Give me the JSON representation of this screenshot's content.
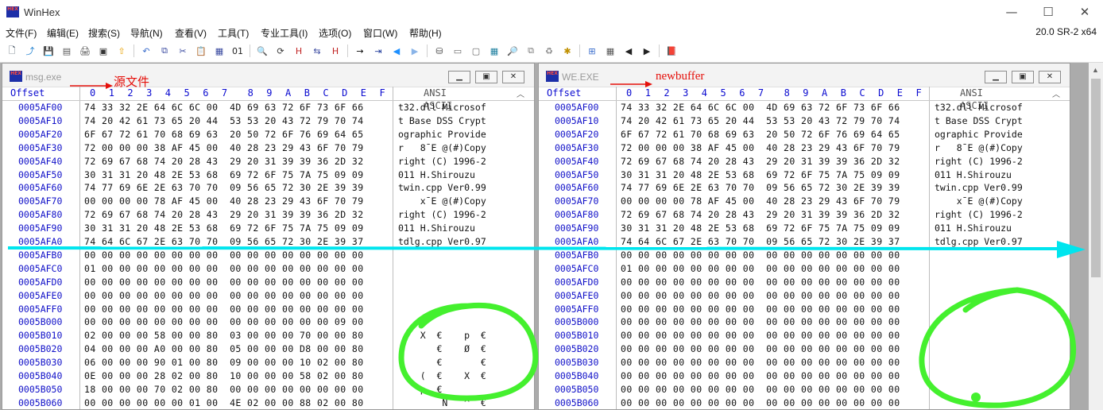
{
  "app": {
    "title": "WinHex",
    "icon_text": "HEX",
    "version": "20.0 SR-2 x64",
    "window_buttons": [
      "—",
      "☐",
      "✕"
    ]
  },
  "menu": [
    "文件(F)",
    "编辑(E)",
    "搜索(S)",
    "导航(N)",
    "查看(V)",
    "工具(T)",
    "专业工具(I)",
    "选项(O)",
    "窗口(W)",
    "帮助(H)"
  ],
  "toolbar_icons": [
    "new-file-icon",
    "open-file-icon",
    "save-icon",
    "save-all-icon",
    "print-icon",
    "properties-icon",
    "open-folder-icon",
    "undo-icon",
    "copy-icon",
    "cut-icon",
    "paste-icon",
    "paste-special-icon",
    "binary-icon",
    "find-icon",
    "find-again-icon",
    "find-hex-icon",
    "replace-icon",
    "replace-hex-icon",
    "goto-offset-icon",
    "goto-sector-icon",
    "back-icon",
    "forward-icon",
    "open-disk-icon",
    "open-ram-icon",
    "hdd-icon",
    "calculator-icon",
    "search-disk-icon",
    "clone-icon",
    "recover-icon",
    "plugin-icon",
    "compare-icon",
    "table-icon",
    "prev-icon",
    "next-icon",
    "book-icon"
  ],
  "colors": {
    "annotation_red": "#e5100b",
    "cyan_arrow": "#00e5ee",
    "green_circle": "#44f02e",
    "offset_blue": "#1010c8"
  },
  "header": {
    "offset_label": "Offset",
    "hex_labels": [
      "0",
      "1",
      "2",
      "3",
      "4",
      "5",
      "6",
      "7",
      "8",
      "9",
      "A",
      "B",
      "C",
      "D",
      "E",
      "F"
    ],
    "ansi_label": "ANSI ASCII"
  },
  "left_panel": {
    "title": "msg.exe",
    "annotation": "源文件",
    "rows": [
      {
        "offset": "0005AF00",
        "hex": "74 33 32 2E 64 6C 6C 00  4D 69 63 72 6F 73 6F 66",
        "ansi": "t32.dll Microsof"
      },
      {
        "offset": "0005AF10",
        "hex": "74 20 42 61 73 65 20 44  53 53 20 43 72 79 70 74",
        "ansi": "t Base DSS Crypt"
      },
      {
        "offset": "0005AF20",
        "hex": "6F 67 72 61 70 68 69 63  20 50 72 6F 76 69 64 65",
        "ansi": "ographic Provide"
      },
      {
        "offset": "0005AF30",
        "hex": "72 00 00 00 38 AF 45 00  40 28 23 29 43 6F 70 79",
        "ansi": "r   8¯E @(#)Copy"
      },
      {
        "offset": "0005AF40",
        "hex": "72 69 67 68 74 20 28 43  29 20 31 39 39 36 2D 32",
        "ansi": "right (C) 1996-2"
      },
      {
        "offset": "0005AF50",
        "hex": "30 31 31 20 48 2E 53 68  69 72 6F 75 7A 75 09 09",
        "ansi": "011 H.Shirouzu  "
      },
      {
        "offset": "0005AF60",
        "hex": "74 77 69 6E 2E 63 70 70  09 56 65 72 30 2E 39 39",
        "ansi": "twin.cpp Ver0.99"
      },
      {
        "offset": "0005AF70",
        "hex": "00 00 00 00 78 AF 45 00  40 28 23 29 43 6F 70 79",
        "ansi": "    x¯E @(#)Copy"
      },
      {
        "offset": "0005AF80",
        "hex": "72 69 67 68 74 20 28 43  29 20 31 39 39 36 2D 32",
        "ansi": "right (C) 1996-2"
      },
      {
        "offset": "0005AF90",
        "hex": "30 31 31 20 48 2E 53 68  69 72 6F 75 7A 75 09 09",
        "ansi": "011 H.Shirouzu  "
      },
      {
        "offset": "0005AFA0",
        "hex": "74 64 6C 67 2E 63 70 70  09 56 65 72 30 2E 39 37",
        "ansi": "tdlg.cpp Ver0.97"
      },
      {
        "offset": "0005AFB0",
        "hex": "00 00 00 00 00 00 00 00  00 00 00 00 00 00 00 00",
        "ansi": ""
      },
      {
        "offset": "0005AFC0",
        "hex": "01 00 00 00 00 00 00 00  00 00 00 00 00 00 00 00",
        "ansi": ""
      },
      {
        "offset": "0005AFD0",
        "hex": "00 00 00 00 00 00 00 00  00 00 00 00 00 00 00 00",
        "ansi": ""
      },
      {
        "offset": "0005AFE0",
        "hex": "00 00 00 00 00 00 00 00  00 00 00 00 00 00 00 00",
        "ansi": ""
      },
      {
        "offset": "0005AFF0",
        "hex": "00 00 00 00 00 00 00 00  00 00 00 00 00 00 00 00",
        "ansi": ""
      },
      {
        "offset": "0005B000",
        "hex": "00 00 00 00 00 00 00 00  00 00 00 00 00 00 09 00",
        "ansi": ""
      },
      {
        "offset": "0005B010",
        "hex": "02 00 00 00 58 00 00 80  03 00 00 00 70 00 00 80",
        "ansi": "    X  €    p  €"
      },
      {
        "offset": "0005B020",
        "hex": "04 00 00 00 A0 00 00 80  05 00 00 00 D8 00 00 80",
        "ansi": "       €    Ø  €"
      },
      {
        "offset": "0005B030",
        "hex": "06 00 00 00 90 01 00 80  09 00 00 00 10 02 00 80",
        "ansi": "       €       €"
      },
      {
        "offset": "0005B040",
        "hex": "0E 00 00 00 28 02 00 80  10 00 00 00 58 02 00 80",
        "ansi": "    (  €    X  €"
      },
      {
        "offset": "0005B050",
        "hex": "18 00 00 00 70 02 00 80  00 00 00 00 00 00 00 00",
        "ansi": "    p  €        "
      },
      {
        "offset": "0005B060",
        "hex": "00 00 00 00 00 00 01 00  4E 02 00 00 88 02 00 80",
        "ansi": "        N   ^  €"
      }
    ]
  },
  "right_panel": {
    "title": "WE.EXE",
    "annotation": "newbuffer",
    "rows": [
      {
        "offset": "0005AF00",
        "hex": "74 33 32 2E 64 6C 6C 00  4D 69 63 72 6F 73 6F 66",
        "ansi": "t32.dll Microsof"
      },
      {
        "offset": "0005AF10",
        "hex": "74 20 42 61 73 65 20 44  53 53 20 43 72 79 70 74",
        "ansi": "t Base DSS Crypt"
      },
      {
        "offset": "0005AF20",
        "hex": "6F 67 72 61 70 68 69 63  20 50 72 6F 76 69 64 65",
        "ansi": "ographic Provide"
      },
      {
        "offset": "0005AF30",
        "hex": "72 00 00 00 38 AF 45 00  40 28 23 29 43 6F 70 79",
        "ansi": "r   8¯E @(#)Copy"
      },
      {
        "offset": "0005AF40",
        "hex": "72 69 67 68 74 20 28 43  29 20 31 39 39 36 2D 32",
        "ansi": "right (C) 1996-2"
      },
      {
        "offset": "0005AF50",
        "hex": "30 31 31 20 48 2E 53 68  69 72 6F 75 7A 75 09 09",
        "ansi": "011 H.Shirouzu  "
      },
      {
        "offset": "0005AF60",
        "hex": "74 77 69 6E 2E 63 70 70  09 56 65 72 30 2E 39 39",
        "ansi": "twin.cpp Ver0.99"
      },
      {
        "offset": "0005AF70",
        "hex": "00 00 00 00 78 AF 45 00  40 28 23 29 43 6F 70 79",
        "ansi": "    x¯E @(#)Copy"
      },
      {
        "offset": "0005AF80",
        "hex": "72 69 67 68 74 20 28 43  29 20 31 39 39 36 2D 32",
        "ansi": "right (C) 1996-2"
      },
      {
        "offset": "0005AF90",
        "hex": "30 31 31 20 48 2E 53 68  69 72 6F 75 7A 75 09 09",
        "ansi": "011 H.Shirouzu  "
      },
      {
        "offset": "0005AFA0",
        "hex": "74 64 6C 67 2E 63 70 70  09 56 65 72 30 2E 39 37",
        "ansi": "tdlg.cpp Ver0.97"
      },
      {
        "offset": "0005AFB0",
        "hex": "00 00 00 00 00 00 00 00  00 00 00 00 00 00 00 00",
        "ansi": ""
      },
      {
        "offset": "0005AFC0",
        "hex": "01 00 00 00 00 00 00 00  00 00 00 00 00 00 00 00",
        "ansi": ""
      },
      {
        "offset": "0005AFD0",
        "hex": "00 00 00 00 00 00 00 00  00 00 00 00 00 00 00 00",
        "ansi": ""
      },
      {
        "offset": "0005AFE0",
        "hex": "00 00 00 00 00 00 00 00  00 00 00 00 00 00 00 00",
        "ansi": ""
      },
      {
        "offset": "0005AFF0",
        "hex": "00 00 00 00 00 00 00 00  00 00 00 00 00 00 00 00",
        "ansi": ""
      },
      {
        "offset": "0005B000",
        "hex": "00 00 00 00 00 00 00 00  00 00 00 00 00 00 00 00",
        "ansi": ""
      },
      {
        "offset": "0005B010",
        "hex": "00 00 00 00 00 00 00 00  00 00 00 00 00 00 00 00",
        "ansi": ""
      },
      {
        "offset": "0005B020",
        "hex": "00 00 00 00 00 00 00 00  00 00 00 00 00 00 00 00",
        "ansi": ""
      },
      {
        "offset": "0005B030",
        "hex": "00 00 00 00 00 00 00 00  00 00 00 00 00 00 00 00",
        "ansi": ""
      },
      {
        "offset": "0005B040",
        "hex": "00 00 00 00 00 00 00 00  00 00 00 00 00 00 00 00",
        "ansi": ""
      },
      {
        "offset": "0005B050",
        "hex": "00 00 00 00 00 00 00 00  00 00 00 00 00 00 00 00",
        "ansi": ""
      },
      {
        "offset": "0005B060",
        "hex": "00 00 00 00 00 00 00 00  00 00 00 00 00 00 00 00",
        "ansi": ""
      }
    ]
  }
}
